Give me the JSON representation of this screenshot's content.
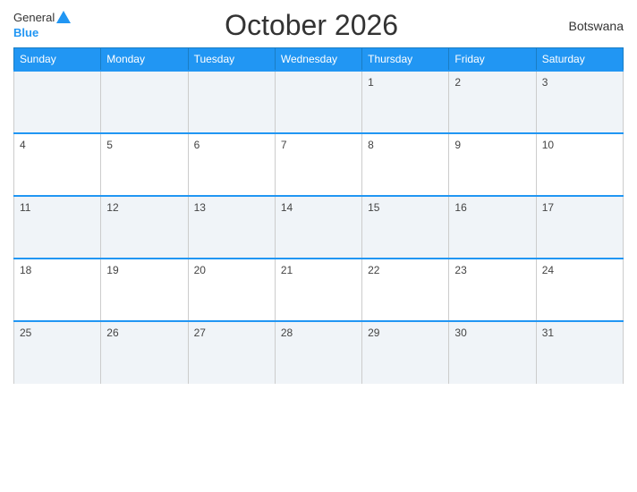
{
  "header": {
    "logo_general": "General",
    "logo_blue": "Blue",
    "title": "October 2026",
    "country": "Botswana"
  },
  "days_of_week": [
    "Sunday",
    "Monday",
    "Tuesday",
    "Wednesday",
    "Thursday",
    "Friday",
    "Saturday"
  ],
  "weeks": [
    [
      null,
      null,
      null,
      null,
      1,
      2,
      3
    ],
    [
      4,
      5,
      6,
      7,
      8,
      9,
      10
    ],
    [
      11,
      12,
      13,
      14,
      15,
      16,
      17
    ],
    [
      18,
      19,
      20,
      21,
      22,
      23,
      24
    ],
    [
      25,
      26,
      27,
      28,
      29,
      30,
      31
    ]
  ]
}
